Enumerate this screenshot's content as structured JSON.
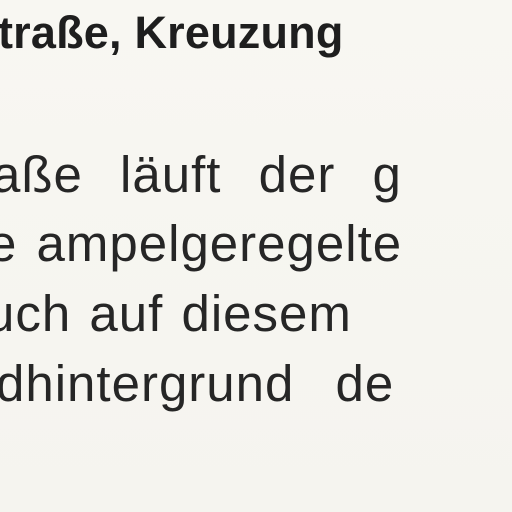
{
  "heading": "traße, Kreuzung",
  "lines": [
    "aße läuft der g",
    "e ampelgeregelte",
    "uch auf diesem",
    "dhintergrund de"
  ]
}
